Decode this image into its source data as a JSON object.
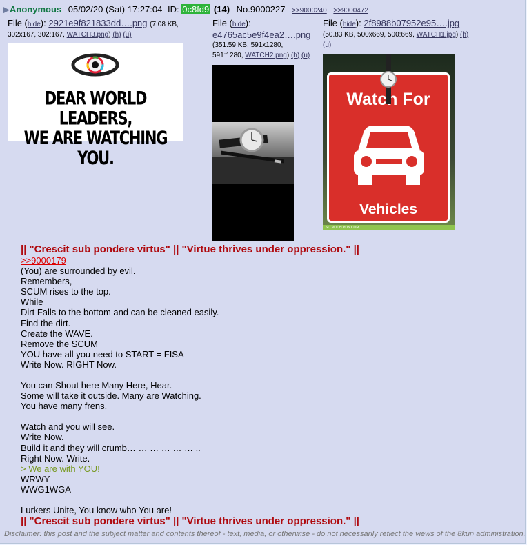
{
  "header": {
    "arrow": "▶",
    "name": "Anonymous",
    "date": "05/02/20 (Sat) 17:27:04",
    "id_label": "ID:",
    "id": "0c8fd9",
    "count": "(14)",
    "number": "No.9000227",
    "backlinks": [
      ">>9000240",
      ">>9000472"
    ]
  },
  "files": [
    {
      "prefix": "File (",
      "hide": "hide",
      "suffix": "):",
      "filename": "2921e9f821833dd….png",
      "info_line1": "(7.08 KB,",
      "info_line2": "302x167, 302:167,",
      "orig": "WATCH3.png",
      "h": "(h)",
      "u": "(u)",
      "thumb_text1": "DEAR WORLD LEADERS,",
      "thumb_text2": "WE ARE WATCHING YOU."
    },
    {
      "prefix": "File (",
      "hide": "hide",
      "suffix": "):",
      "filename": "e4765ac5e9f4ea2….png",
      "info_line1": "(351.59 KB, 591x1280,",
      "info_line2": "591:1280,",
      "orig": "WATCH2.png",
      "h": "(h)",
      "u": "(u)"
    },
    {
      "prefix": "File (",
      "hide": "hide",
      "suffix": "):",
      "filename": "2f8988b07952e95….jpg",
      "info_line1": "(50.83 KB, 500x669, 500:669,",
      "orig": "WATCH1.jpg",
      "h": "(h)",
      "u": "(u)",
      "thumb_text1": "Watch For",
      "thumb_text2": "Vehicles",
      "thumb_credit": "SO MUCH PUN.COM"
    }
  ],
  "body": {
    "heading_top": "|| \"Crescit sub pondere virtus\" || \"Virtue thrives under oppression.\" ||",
    "quotelink": ">>9000179",
    "lines": [
      "(You) are surrounded by evil.",
      "Remembers,",
      "SCUM rises to the top.",
      "While",
      "Dirt Falls to the bottom and can be cleaned easily.",
      "Find the dirt.",
      "Create the WAVE.",
      "Remove the SCUM",
      "YOU have all you need to START = FISA",
      "Write Now. RIGHT Now.",
      "",
      "You can Shout here Many Here, Hear.",
      "Some will take it outside. Many are Watching.",
      "You have many frens.",
      "",
      "Watch and you will see.",
      "Write Now.",
      "Build it and they will crumb… … … … … … ..",
      "Right Now. Write."
    ],
    "greentext": "> We are with YOU!",
    "lines2": [
      "WRWY",
      "WWG1WGA",
      "",
      "Lurkers Unite, You know who You are!"
    ],
    "heading_bottom": "|| \"Crescit sub pondere virtus\" || \"Virtue thrives under oppression.\" ||"
  },
  "disclaimer": "Disclaimer: this post and the subject matter and contents thereof - text, media, or otherwise - do not necessarily reflect the views of the 8kun administration.",
  "colors": {
    "name": "#117743",
    "id_bg": "#2db33a",
    "heading": "#af0a0f",
    "greentext": "#789922",
    "post_bg": "#d6daf0"
  }
}
